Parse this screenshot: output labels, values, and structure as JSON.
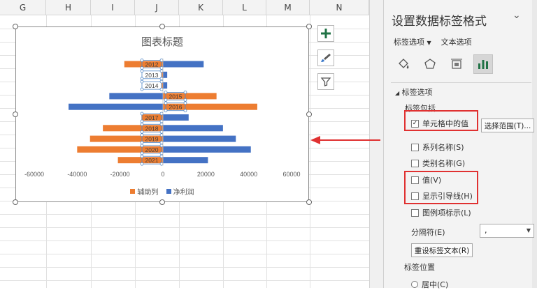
{
  "sheet": {
    "columns": [
      {
        "label": "G"
      },
      {
        "label": "H"
      },
      {
        "label": "I"
      },
      {
        "label": "J"
      },
      {
        "label": "K"
      },
      {
        "label": "L"
      },
      {
        "label": "M"
      },
      {
        "label": "N"
      }
    ]
  },
  "chart": {
    "title": "图表标题",
    "series_colors": {
      "辅助列": "#ED7D31",
      "净利润": "#4472C4"
    },
    "icons": [
      "plus-icon",
      "brush-icon",
      "filter-icon"
    ]
  },
  "chart_data": {
    "type": "bar",
    "orientation": "horizontal",
    "title": "图表标题",
    "categories": [
      "2012",
      "2013",
      "2014",
      "2015",
      "2016",
      "2017",
      "2018",
      "2019",
      "2020",
      "2021"
    ],
    "series": [
      {
        "name": "辅助列",
        "values": [
          -18000,
          -1000,
          -3000,
          25000,
          44000,
          -10000,
          -28000,
          -34000,
          -40000,
          -21000
        ]
      },
      {
        "name": "净利润",
        "values": [
          19000,
          2000,
          2000,
          -25000,
          -44000,
          12000,
          28000,
          34000,
          41000,
          21000
        ]
      }
    ],
    "xlim": [
      -60000,
      60000
    ],
    "xticks": [
      "-60000",
      "-40000",
      "-20000",
      "0",
      "20000",
      "40000",
      "60000"
    ],
    "legend_position": "bottom",
    "grid": false
  },
  "pane": {
    "title": "设置数据标签格式",
    "tabs": [
      "标签选项",
      "文本选项"
    ],
    "icons": [
      "fill-icon",
      "pentagon-icon",
      "size-icon",
      "bar-chart-icon"
    ],
    "section": "标签选项",
    "include_label": "标签包括",
    "checks": {
      "cell_value": "单元格中的值",
      "series_name": "系列名称(S)",
      "category_name": "类别名称(G)",
      "value": "值(V)",
      "leader_lines": "显示引导线(H)",
      "legend_key": "图例项标示(L)"
    },
    "select_range_button": "选择范围(T)...",
    "separator_label": "分隔符(E)",
    "separator_value": ",",
    "reset_button": "重设标签文本(R)",
    "position_label": "标签位置",
    "center_radio": "居中(C)"
  },
  "colors": {
    "accent_red": "#E03131",
    "excel_green": "#217346"
  }
}
